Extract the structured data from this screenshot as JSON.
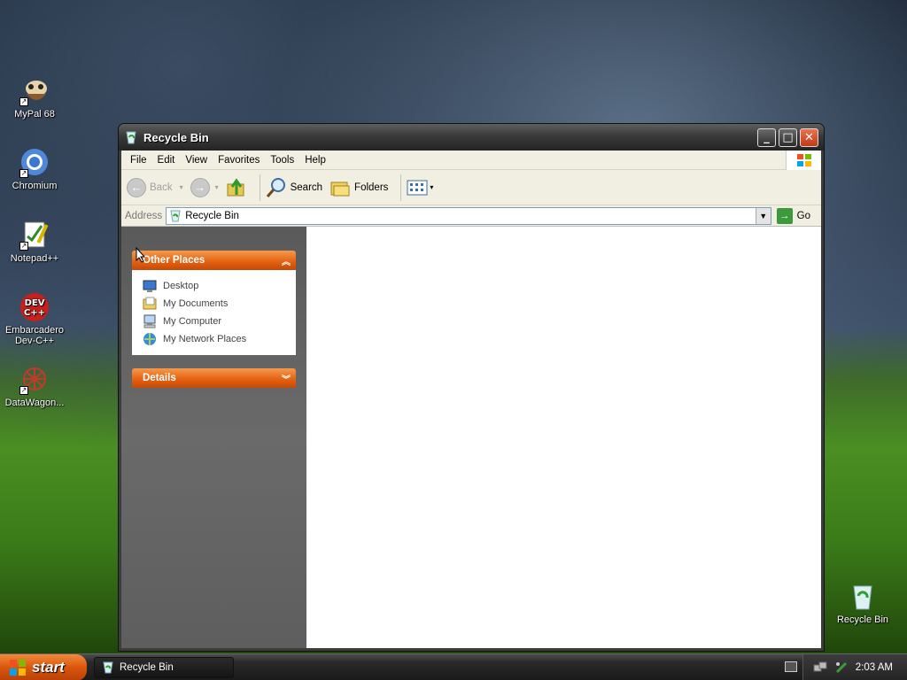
{
  "desktop": {
    "icons": [
      {
        "label": "MyPal 68",
        "icon": "mypal-icon"
      },
      {
        "label": "Chromium",
        "icon": "chromium-icon"
      },
      {
        "label": "Notepad++",
        "icon": "notepadpp-icon"
      },
      {
        "label": "Embarcadero Dev-C++",
        "icon": "devcpp-icon"
      },
      {
        "label": "DataWagon...",
        "icon": "datawagon-icon"
      },
      {
        "label": "Recycle Bin",
        "icon": "recycle-bin-icon"
      }
    ],
    "devcpp_icon_text": "DEV\nC++"
  },
  "window": {
    "title": "Recycle Bin",
    "menu": [
      "File",
      "Edit",
      "View",
      "Favorites",
      "Tools",
      "Help"
    ],
    "toolbar": {
      "back": "Back",
      "search": "Search",
      "folders": "Folders"
    },
    "address": {
      "label": "Address",
      "value": "Recycle Bin",
      "go": "Go"
    },
    "taskpane": {
      "other_places": {
        "title": "Other Places",
        "items": [
          "Desktop",
          "My Documents",
          "My Computer",
          "My Network Places"
        ]
      },
      "details": {
        "title": "Details"
      }
    }
  },
  "taskbar": {
    "start": "start",
    "task": "Recycle Bin",
    "clock": "2:03 AM"
  },
  "colors": {
    "accent_orange": "#e35f10",
    "title_dark": "#2a2a2a"
  }
}
